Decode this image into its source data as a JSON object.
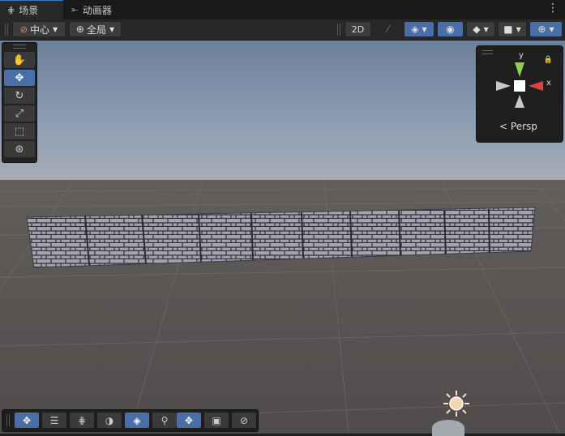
{
  "tabs": [
    {
      "label": "场景",
      "icon": "grid-icon",
      "active": true
    },
    {
      "label": "动画器",
      "icon": "animator-icon",
      "active": false
    }
  ],
  "toolbar": {
    "pivot_label": "中心",
    "space_label": "全局",
    "right_icons": [
      "2d-icon",
      "lighting-icon",
      "draw-mode-icon",
      "visibility-icon",
      "layers-icon",
      "camera-icon",
      "gizmos-icon"
    ]
  },
  "tools": [
    "hand-tool",
    "move-tool",
    "rotate-tool",
    "scale-tool",
    "rect-tool",
    "transform-tool"
  ],
  "active_tool": "move-tool",
  "gizmo": {
    "y": "y",
    "x": "x",
    "projection": "Persp"
  },
  "colors": {
    "accent": "#4a6ea8",
    "x_axis": "#d8473f",
    "y_axis": "#8fd14f",
    "sky": "#93a4b9",
    "ground": "#545150"
  },
  "overlay_tools": [
    "move-overlay",
    "align-overlay",
    "grid-snap-overlay",
    "shading-overlay",
    "surface-snap-overlay",
    "search-overlay",
    "pivot-overlay",
    "camera-overlay",
    "navigation-overlay"
  ]
}
